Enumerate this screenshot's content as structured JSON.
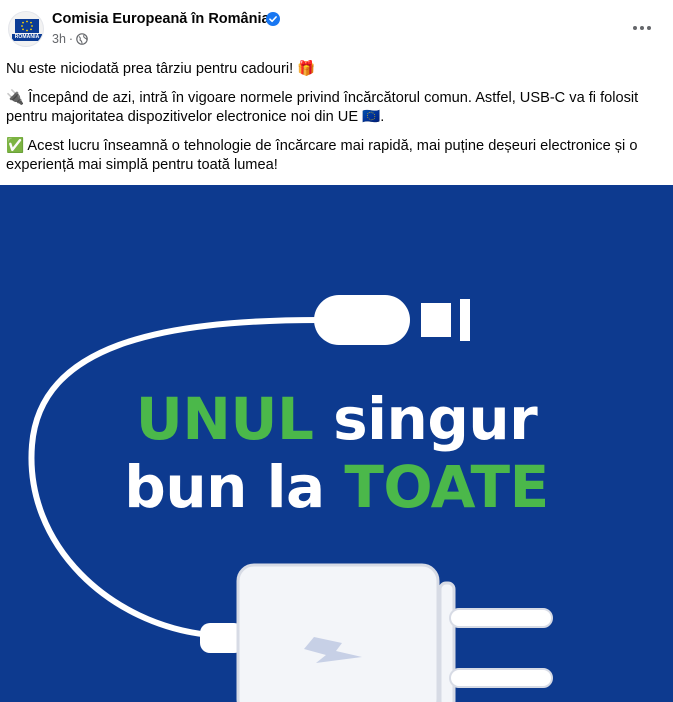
{
  "header": {
    "page_name": "Comisia Europeană în România",
    "avatar_label": "ROMÂNIA",
    "time": "3h",
    "separator": "·"
  },
  "post": {
    "line1": "Nu este niciodată prea târziu pentru cadouri! 🎁",
    "line2": "🔌 Începând de azi, intră în vigoare normele privind încărcătorul comun. Astfel, USB-C va fi folosit pentru majoritatea dispozitivelor electronice noi din UE 🇪🇺.",
    "line3": "✅ Acest lucru înseamnă o tehnologie de încărcare mai rapidă, mai puține deșeuri electronice și o experiență mai simplă pentru toată lumea!"
  },
  "image_text": {
    "word1": "UNUL",
    "word2": " singur",
    "word3": "bun la ",
    "word4": "TOATE"
  },
  "colors": {
    "background_blue": "#0d3a8f",
    "green": "#4bb84a",
    "verified_blue": "#1877f2"
  },
  "icons": [
    "verified-badge-icon",
    "globe-icon",
    "more-options-icon",
    "gift-emoji",
    "plug-emoji",
    "eu-flag-emoji",
    "check-emoji"
  ]
}
